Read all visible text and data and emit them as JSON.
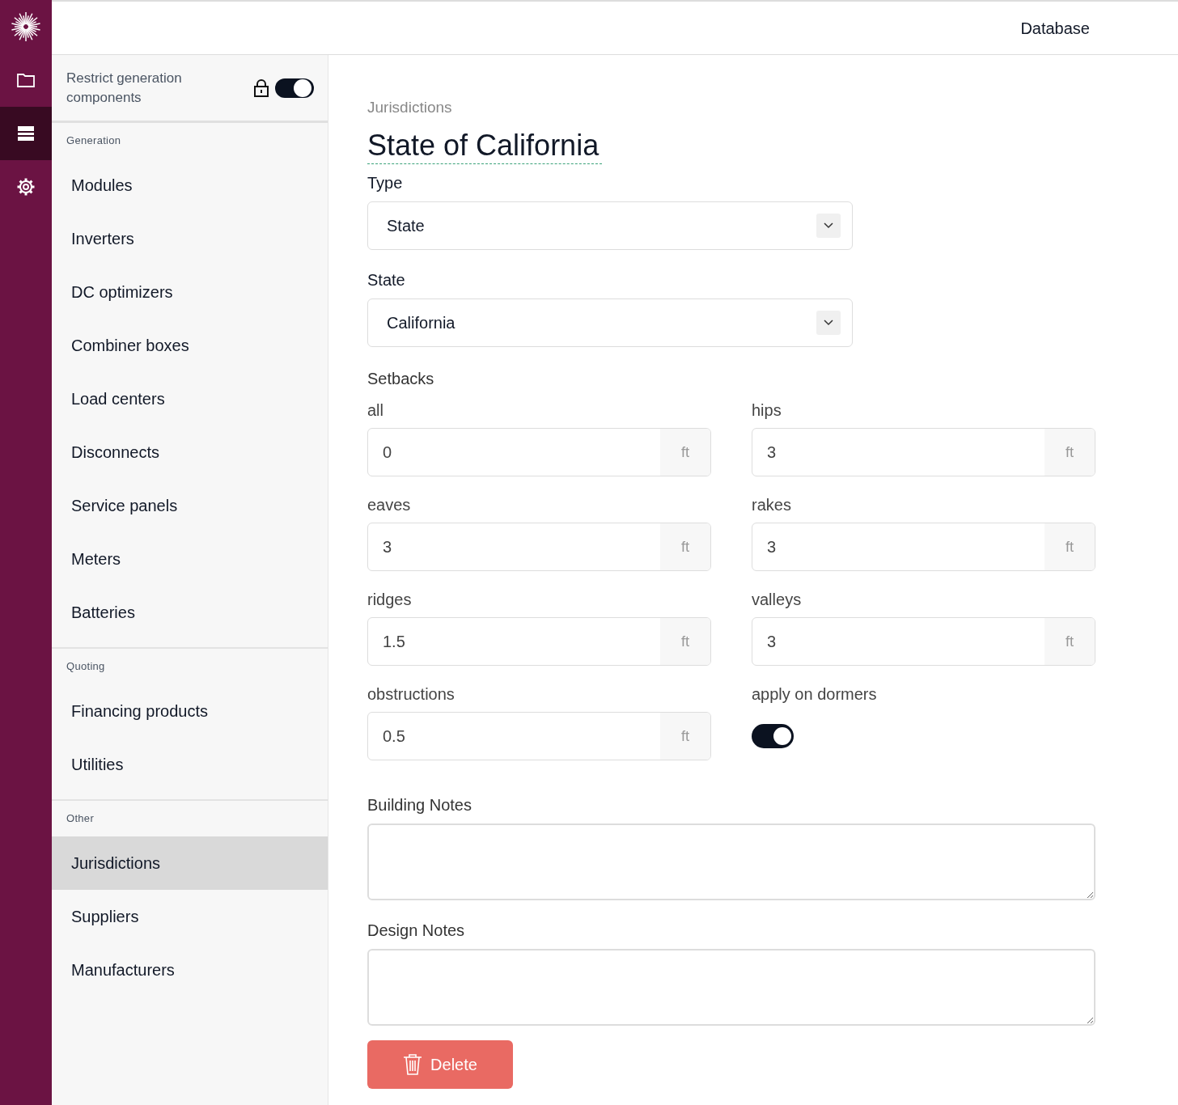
{
  "rail": [
    {
      "kind": "folder",
      "selected": false
    },
    {
      "kind": "list",
      "selected": true
    },
    {
      "kind": "gear",
      "selected": false
    }
  ],
  "header": {
    "title": "Database"
  },
  "sidebar": {
    "restrict": {
      "label": "Restrict generation components",
      "on": true
    },
    "sections": [
      {
        "title": "Generation",
        "items": [
          {
            "label": "Modules",
            "selected": false
          },
          {
            "label": "Inverters",
            "selected": false
          },
          {
            "label": "DC optimizers",
            "selected": false
          },
          {
            "label": "Combiner boxes",
            "selected": false
          },
          {
            "label": "Load centers",
            "selected": false
          },
          {
            "label": "Disconnects",
            "selected": false
          },
          {
            "label": "Service panels",
            "selected": false
          },
          {
            "label": "Meters",
            "selected": false
          },
          {
            "label": "Batteries",
            "selected": false
          }
        ]
      },
      {
        "title": "Quoting",
        "items": [
          {
            "label": "Financing products",
            "selected": false
          },
          {
            "label": "Utilities",
            "selected": false
          }
        ]
      },
      {
        "title": "Other",
        "items": [
          {
            "label": "Jurisdictions",
            "selected": true
          },
          {
            "label": "Suppliers",
            "selected": false
          },
          {
            "label": "Manufacturers",
            "selected": false
          }
        ]
      }
    ]
  },
  "main": {
    "breadcrumb": "Jurisdictions",
    "title": "State of California",
    "selects": [
      {
        "label": "Type",
        "value": "State"
      },
      {
        "label": "State",
        "value": "California"
      }
    ],
    "setbacks_title": "Setbacks",
    "setbacks": [
      {
        "kind": "number",
        "label": "all",
        "value": "0",
        "unit": "ft"
      },
      {
        "kind": "number",
        "label": "hips",
        "value": "3",
        "unit": "ft"
      },
      {
        "kind": "number",
        "label": "eaves",
        "value": "3",
        "unit": "ft"
      },
      {
        "kind": "number",
        "label": "rakes",
        "value": "3",
        "unit": "ft"
      },
      {
        "kind": "number",
        "label": "ridges",
        "value": "1.5",
        "unit": "ft"
      },
      {
        "kind": "number",
        "label": "valleys",
        "value": "3",
        "unit": "ft"
      },
      {
        "kind": "number",
        "label": "obstructions",
        "value": "0.5",
        "unit": "ft"
      },
      {
        "kind": "toggle",
        "label": "apply on dormers",
        "on": true
      }
    ],
    "notes": [
      {
        "label": "Building Notes"
      },
      {
        "label": "Design Notes"
      }
    ],
    "delete_button": "Delete"
  }
}
